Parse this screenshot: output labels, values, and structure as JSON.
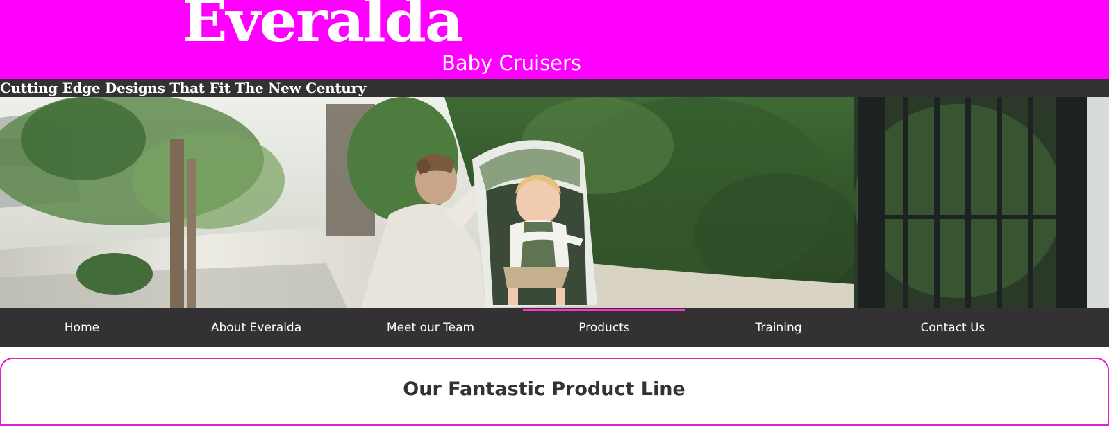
{
  "brand": {
    "logo_text": "Everalda",
    "subtitle": "Baby Cruisers",
    "tagline": "Cutting Edge Designs That Fit The New Century"
  },
  "hero": {
    "image": "mother-with-child-in-stroller-photo"
  },
  "nav": {
    "items": [
      {
        "label": "Home"
      },
      {
        "label": "About Everalda"
      },
      {
        "label": "Meet our Team"
      },
      {
        "label": "Products",
        "active": true
      },
      {
        "label": "Training"
      },
      {
        "label": "Contact Us"
      }
    ]
  },
  "section": {
    "title": "Our Fantastic Product Line"
  },
  "colors": {
    "header_bg": "#ff00ff",
    "bar_bg": "#343135",
    "accent": "#e620c8"
  }
}
